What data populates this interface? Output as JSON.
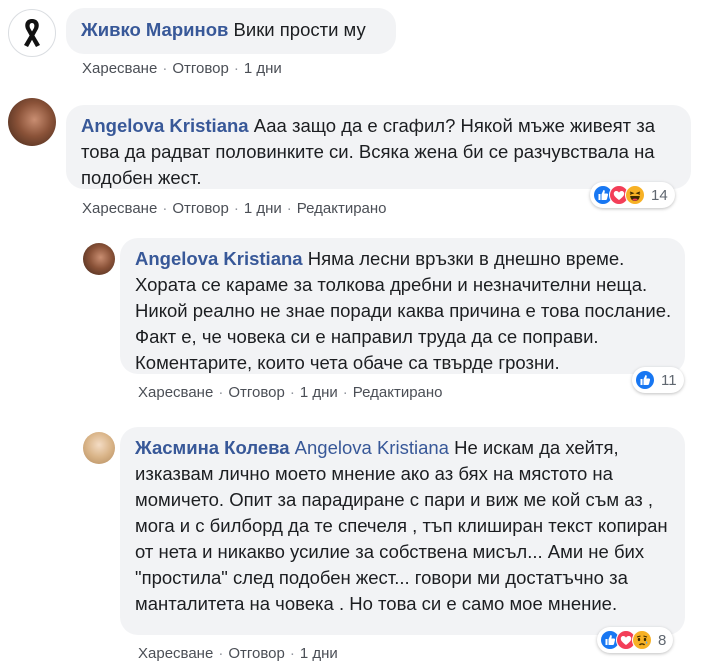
{
  "colors": {
    "author": "#385898",
    "like": "#1877f2",
    "love": "#f33e58",
    "haha": "#f7b125",
    "bubble": "#f2f3f5"
  },
  "comments": [
    {
      "author": "Живко Маринов",
      "text": "Вики прости му",
      "actions": {
        "like": "Харесване",
        "reply": "Отговор",
        "time": "1 дни"
      },
      "avatar_icon": "black-ribbon-icon"
    },
    {
      "author": "Angelova Kristiana",
      "text": "Ааа защо да е сгафил? Някой мъже живеят за това да радват половинките си. Всяка жена би се разчувствала на подобен жест.",
      "actions": {
        "like": "Харесване",
        "reply": "Отговор",
        "time": "1 дни",
        "edited": "Редактирано"
      },
      "reactions": {
        "icons": [
          "like-icon",
          "love-icon",
          "haha-icon"
        ],
        "count": "14"
      }
    },
    {
      "author": "Angelova Kristiana",
      "text": "Няма лесни връзки в днешно време. Хората се караме за толкова дребни и незначителни неща. Никой реално не знае поради каква причина е това послание. Факт е, че човека си е направил труда да се поправи. Коментарите, които чета обаче са твърде грозни.",
      "actions": {
        "like": "Харесване",
        "reply": "Отговор",
        "time": "1 дни",
        "edited": "Редактирано"
      },
      "reactions": {
        "icons": [
          "like-icon"
        ],
        "count": "11"
      }
    },
    {
      "author": "Жасмина Колева",
      "mention": "Angelova Kristiana",
      "text": "Не искам да хейтя, изказвам лично моето мнение ако аз бях на мястото на момичето. Опит за парадиране с пари и виж ме кой съм аз , мога и с билборд да те спечеля , тъп клиширан текст копиран от нета и никакво усилие за собствена мисъл... Ами не бих \"простила\" след подобен жест... говори ми достатъчно за манталитета на човека . Но това си е само мое мнение.",
      "actions": {
        "like": "Харесване",
        "reply": "Отговор",
        "time": "1 дни"
      },
      "reactions": {
        "icons": [
          "like-icon",
          "love-icon",
          "sad-icon"
        ],
        "count": "8"
      }
    }
  ]
}
